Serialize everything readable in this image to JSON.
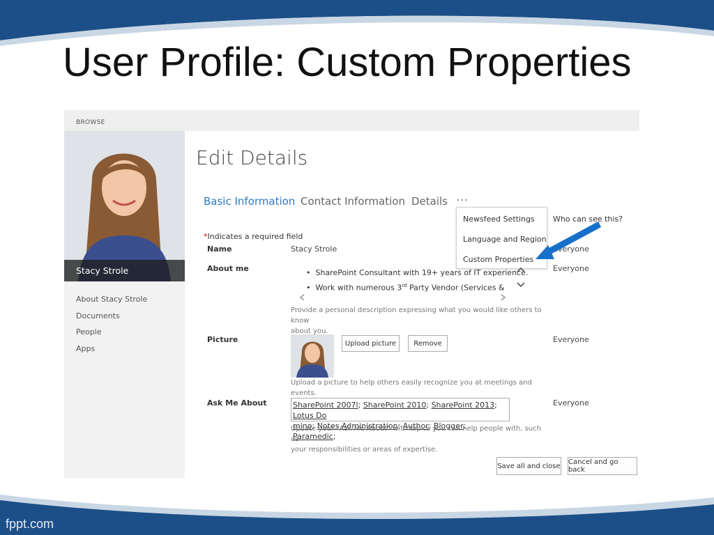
{
  "slide": {
    "title": "User Profile: Custom Properties",
    "footer": "fppt.com",
    "colors": {
      "band": "#1c4f87",
      "accent": "#2a7ac6",
      "arrow": "#1670c9"
    }
  },
  "ribbon": {
    "browse": "BROWSE"
  },
  "profile": {
    "name": "Stacy Strole"
  },
  "leftnav": {
    "items": [
      "About Stacy Strole",
      "Documents",
      "People",
      "Apps"
    ]
  },
  "page": {
    "heading": "Edit Details"
  },
  "tabs": [
    {
      "label": "Basic Information",
      "active": true
    },
    {
      "label": "Contact Information",
      "active": false
    },
    {
      "label": "Details",
      "active": false
    }
  ],
  "more_label": "...",
  "dropdown": {
    "items": [
      "Newsfeed Settings",
      "Language and Region",
      "Custom Properties"
    ]
  },
  "form": {
    "who_header": "Who can see this?",
    "required_star": "*",
    "required_note": "Indicates a required field",
    "name": {
      "label": "Name",
      "value": "Stacy Strole",
      "privacy": "Everyone"
    },
    "about": {
      "label": "About me",
      "bullets": [
        "SharePoint Consultant with 19+ years of IT experience.",
        "Work with numerous 3",
        "rd",
        " Party Vendor (Services &"
      ],
      "help_line1": "Provide a personal description expressing what you would like others to know",
      "help_line2": "about you.",
      "privacy": "Everyone"
    },
    "picture": {
      "label": "Picture",
      "upload": "Upload picture",
      "remove": "Remove",
      "help": "Upload a picture to help others easily recognize you at meetings and events.",
      "privacy": "Everyone"
    },
    "ask": {
      "label": "Ask Me About",
      "tags": [
        "SharePoint 2007l",
        "SharePoint 2010",
        "SharePoint 2013",
        "Lotus Do",
        "mino",
        "Notes Administration",
        "Author",
        "Blogger",
        "Paramedic"
      ],
      "help_line1": "Update your \"Ask Me About\" with topics you can help people with, such as",
      "help_line2": "your responsibilities or areas of expertise.",
      "privacy": "Everyone"
    }
  },
  "actions": {
    "save": "Save all and close",
    "cancel": "Cancel and go back"
  }
}
